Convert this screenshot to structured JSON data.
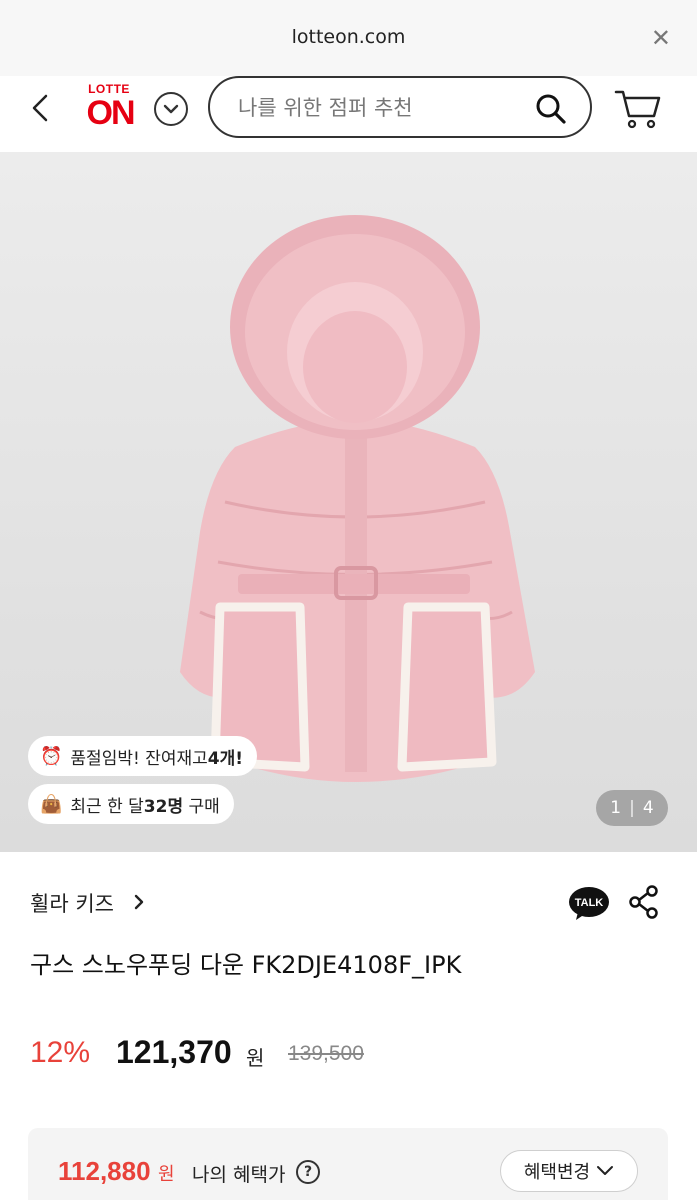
{
  "browser": {
    "url": "lotteon.com",
    "close_glyph": "✕"
  },
  "header": {
    "logo_top": "LOTTE",
    "logo_main": "ON",
    "search_placeholder": "나를 위한 점퍼 추천"
  },
  "gallery": {
    "badge_stock": {
      "icon": "alarm-clock-icon",
      "text": "품절임박! 잔여재고 ",
      "strong": "4개!"
    },
    "badge_sales": {
      "icon": "shopping-bag-icon",
      "text_pre": "최근 한 달 ",
      "strong": "32명",
      "text_post": " 구매"
    },
    "current_page": "1",
    "separator": "|",
    "total_pages": "4"
  },
  "product": {
    "brand": "휠라 키즈",
    "talk_label": "TALK",
    "name": "구스 스노우푸딩 다운 FK2DJE4108F_IPK",
    "discount": "12%",
    "price": "121,370",
    "currency": "원",
    "original_price": "139,500"
  },
  "benefit": {
    "price": "112,880",
    "currency": "원",
    "label": "나의 혜택가",
    "help": "?",
    "change_button": "혜택변경"
  },
  "colors": {
    "accent": "#e60012",
    "sale_red": "#e8423a"
  }
}
